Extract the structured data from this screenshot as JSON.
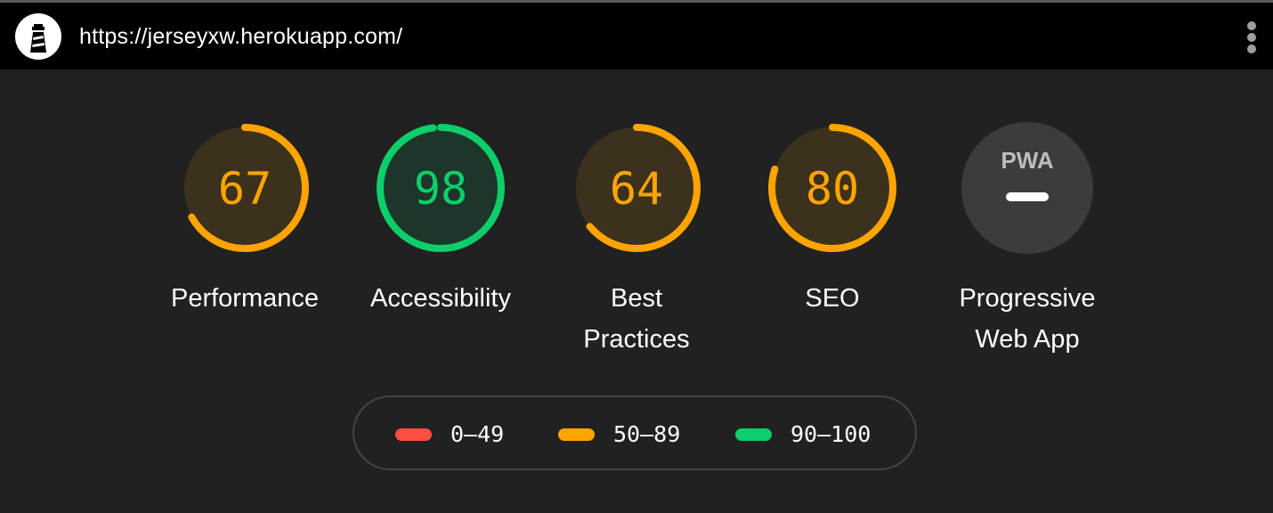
{
  "topbar": {
    "logo_icon": "lighthouse-icon",
    "url": "https://jerseyxw.herokuapp.com/",
    "menu_icon": "vertical-dots-icon"
  },
  "colors": {
    "fail": "#ff4e42",
    "average": "#ffa400",
    "pass": "#0cce6b",
    "pwa_bg": "#3c3c3c"
  },
  "gauges": [
    {
      "label": "Performance",
      "score": "67",
      "value": 0.67,
      "rating": "average"
    },
    {
      "label": "Accessibility",
      "score": "98",
      "value": 0.98,
      "rating": "pass"
    },
    {
      "label": "Best Practices",
      "score": "64",
      "value": 0.64,
      "rating": "average"
    },
    {
      "label": "SEO",
      "score": "80",
      "value": 0.8,
      "rating": "average"
    },
    {
      "label": "Progressive Web App",
      "badge": "PWA",
      "rating": "na"
    }
  ],
  "legend": [
    {
      "range": "0–49",
      "rating": "fail"
    },
    {
      "range": "50–89",
      "rating": "average"
    },
    {
      "range": "90–100",
      "rating": "pass"
    }
  ]
}
